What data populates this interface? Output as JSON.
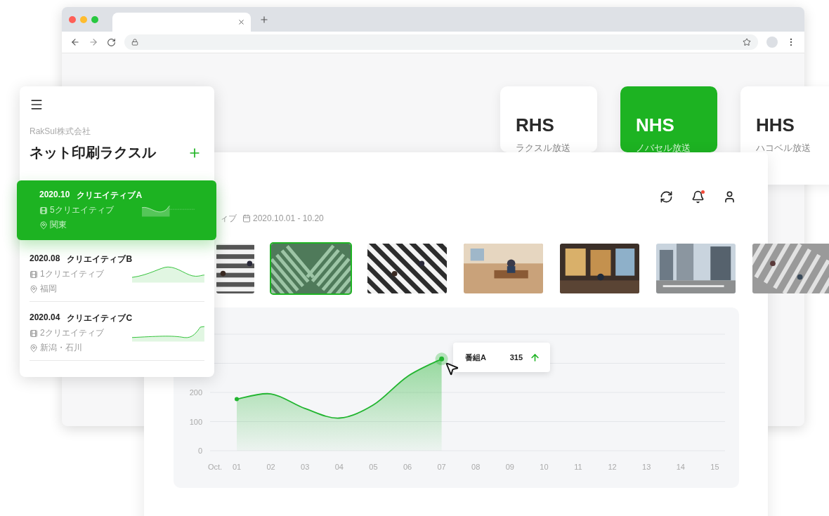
{
  "channels": [
    {
      "code": "RHS",
      "name": "ラクスル放送",
      "selected": false
    },
    {
      "code": "NHS",
      "name": "ノバセル放送",
      "selected": true
    },
    {
      "code": "HHS",
      "name": "ハコベル放送",
      "selected": false
    }
  ],
  "sidebar": {
    "company": "RakSul株式会社",
    "title": "ネット印刷ラクスル",
    "items": [
      {
        "period": "2020.10",
        "title": "クリエイティブA",
        "count": "5クリエイティブ",
        "location": "関東",
        "selected": true
      },
      {
        "period": "2020.08",
        "title": "クリエイティブB",
        "count": "1クリエイティブ",
        "location": "福岡",
        "selected": false
      },
      {
        "period": "2020.04",
        "title": "クリエイティブC",
        "count": "2クリエイティブ",
        "location": "新潟・石川",
        "selected": false
      }
    ]
  },
  "filters": {
    "creative_fragment": "ィブ",
    "date_range": "2020.10.01 - 10.20"
  },
  "thumbnails": [
    {
      "kind": "picture",
      "selected": false
    },
    {
      "kind": "picture",
      "selected": true
    },
    {
      "kind": "picture",
      "selected": false
    },
    {
      "kind": "picture",
      "selected": false
    },
    {
      "kind": "picture",
      "selected": false
    },
    {
      "kind": "picture",
      "selected": false
    },
    {
      "kind": "picture",
      "selected": false
    }
  ],
  "chart": {
    "chart_data": {
      "type": "area",
      "xlabel": "Oct.",
      "categories": [
        "01",
        "02",
        "03",
        "04",
        "05",
        "06",
        "07",
        "08",
        "09",
        "10",
        "11",
        "12",
        "13",
        "14",
        "15"
      ],
      "series": [
        {
          "name": "番組A",
          "color": "#22b530",
          "values": [
            177,
            195,
            145,
            112,
            157,
            255,
            315,
            null,
            null,
            null,
            null,
            null,
            null,
            null,
            null
          ]
        }
      ],
      "ylim": [
        0,
        400
      ],
      "yticks": [
        0,
        100,
        200
      ]
    },
    "tooltip": {
      "value": "315"
    }
  }
}
